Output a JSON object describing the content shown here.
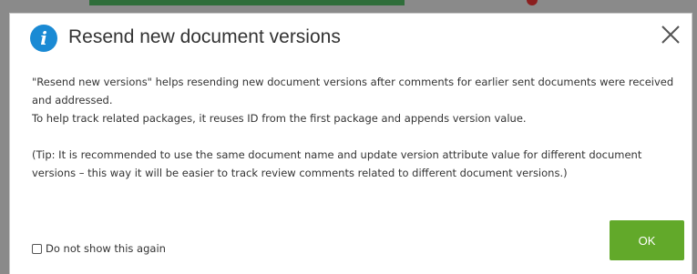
{
  "dialog": {
    "title": "Resend new document versions",
    "icon": "info-icon",
    "close_icon": "close-icon",
    "paragraphs": [
      "\"Resend new versions\" helps resending new document versions after comments for earlier sent documents were received and addressed.",
      "To help track related packages, it reuses ID from the first package and appends version value.",
      "(Tip: It is recommended to use the same document name and update version attribute value for different document versions – this way it will be easier to track review comments related to different document versions.)"
    ],
    "checkbox_label": "Do not show this again",
    "checkbox_checked": false,
    "ok_label": "OK"
  },
  "colors": {
    "info_icon": "#1a8ad4",
    "ok_button": "#62a92a",
    "overlay": "#8a8a8a"
  }
}
